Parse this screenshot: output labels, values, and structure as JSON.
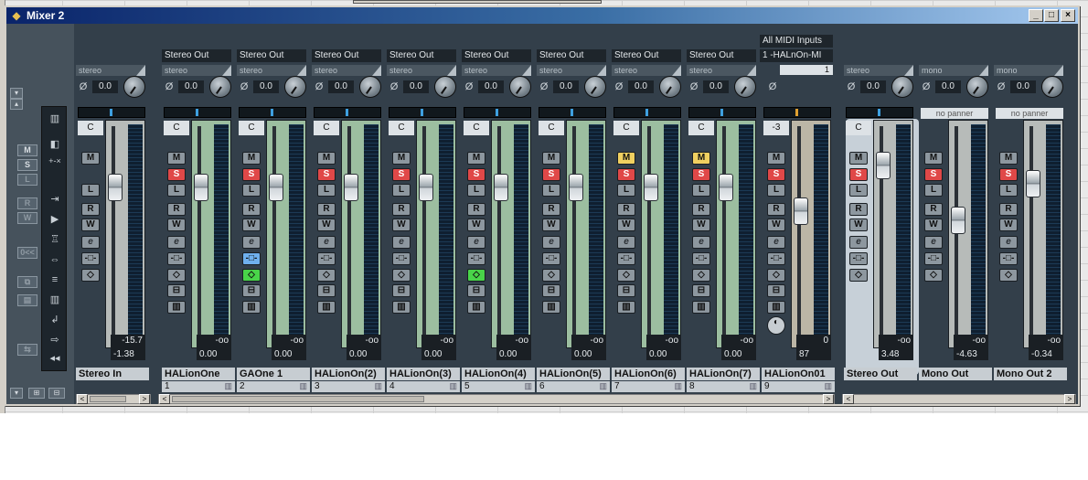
{
  "window": {
    "title": "Mixer 2",
    "minimize": "_",
    "maximize": "□",
    "close": "×"
  },
  "icons": {
    "app": "cubase-icon",
    "phase": "Ø"
  },
  "left_panel": {
    "buttons": [
      "M",
      "S",
      "L",
      "R",
      "W"
    ],
    "small_label": "+-×"
  },
  "midi": {
    "inputs": "All MIDI Inputs",
    "output": "1 -HALnOn-MI",
    "number": "1"
  },
  "channels": [
    {
      "name": "Stereo In",
      "number": "",
      "route": "",
      "mode": "stereo",
      "gain": "0.0",
      "pan": "C",
      "peak": "-15.7",
      "vol": "-1.38",
      "fader": 0.78,
      "color": "grey"
    },
    {
      "name": "HALionOne",
      "number": "1",
      "route": "Stereo Out",
      "mode": "stereo",
      "gain": "0.0",
      "pan": "C",
      "peak": "-oo",
      "vol": "0.00",
      "fader": 0.78,
      "color": "green"
    },
    {
      "name": "GAOne 1",
      "number": "2",
      "route": "Stereo Out",
      "mode": "stereo",
      "gain": "0.0",
      "pan": "C",
      "peak": "-oo",
      "vol": "0.00",
      "fader": 0.78,
      "color": "green"
    },
    {
      "name": "HALionOn(2)",
      "number": "3",
      "route": "Stereo Out",
      "mode": "stereo",
      "gain": "0.0",
      "pan": "C",
      "peak": "-oo",
      "vol": "0.00",
      "fader": 0.78,
      "color": "green"
    },
    {
      "name": "HALionOn(3)",
      "number": "4",
      "route": "Stereo Out",
      "mode": "stereo",
      "gain": "0.0",
      "pan": "C",
      "peak": "-oo",
      "vol": "0.00",
      "fader": 0.78,
      "color": "green"
    },
    {
      "name": "HALionOn(4)",
      "number": "5",
      "route": "Stereo Out",
      "mode": "stereo",
      "gain": "0.0",
      "pan": "C",
      "peak": "-oo",
      "vol": "0.00",
      "fader": 0.78,
      "color": "green"
    },
    {
      "name": "HALionOn(5)",
      "number": "6",
      "route": "Stereo Out",
      "mode": "stereo",
      "gain": "0.0",
      "pan": "C",
      "peak": "-oo",
      "vol": "0.00",
      "fader": 0.78,
      "color": "green"
    },
    {
      "name": "HALionOn(6)",
      "number": "7",
      "route": "Stereo Out",
      "mode": "stereo",
      "gain": "0.0",
      "pan": "C",
      "peak": "-oo",
      "vol": "0.00",
      "fader": 0.78,
      "color": "green"
    },
    {
      "name": "HALionOn(7)",
      "number": "8",
      "route": "Stereo Out",
      "mode": "stereo",
      "gain": "0.0",
      "pan": "C",
      "peak": "-oo",
      "vol": "0.00",
      "fader": 0.78,
      "color": "green"
    },
    {
      "name": "HALionOn01",
      "number": "9",
      "route": "",
      "mode": "",
      "gain": "",
      "pan": "-3",
      "peak": "0",
      "vol": "87",
      "fader": 0.65,
      "color": "tan"
    },
    {
      "name": "Stereo Out",
      "number": "",
      "route": "",
      "mode": "stereo",
      "gain": "0.0",
      "pan": "C",
      "peak": "-oo",
      "vol": "3.48",
      "fader": 0.9,
      "color": "grey"
    },
    {
      "name": "Mono Out",
      "number": "",
      "route": "",
      "mode": "mono",
      "gain": "0.0",
      "pan": "no panner",
      "peak": "-oo",
      "vol": "-4.63",
      "fader": 0.6,
      "color": "grey"
    },
    {
      "name": "Mono Out 2",
      "number": "",
      "route": "",
      "mode": "mono",
      "gain": "0.0",
      "pan": "no panner",
      "peak": "-oo",
      "vol": "-0.34",
      "fader": 0.8,
      "color": "grey"
    }
  ],
  "button_labels": {
    "mute": "M",
    "solo": "S",
    "listen": "L",
    "read": "R",
    "write": "W",
    "edit": "e"
  },
  "scroll": {
    "left": "<",
    "right": ">"
  }
}
